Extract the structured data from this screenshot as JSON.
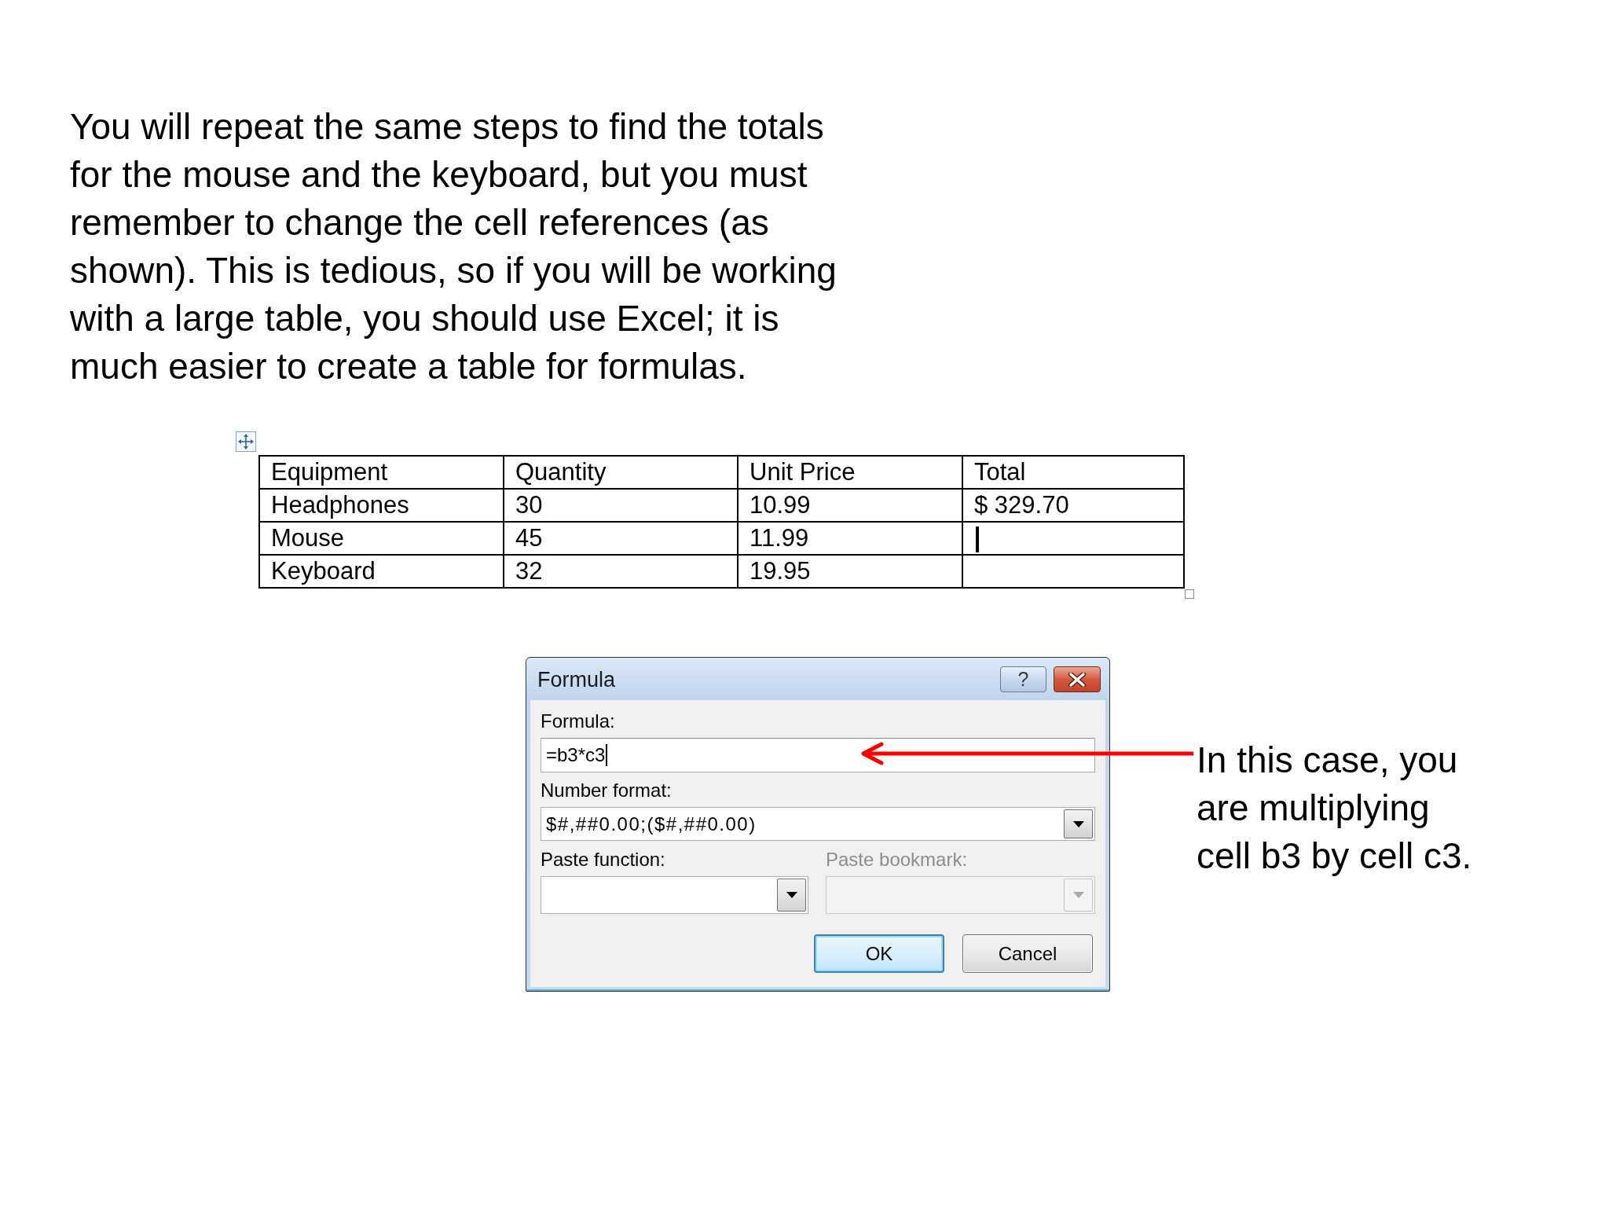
{
  "paragraph": "You will repeat the same steps to find the totals for the mouse and the keyboard, but you must remember to change the cell references (as shown). This is tedious, so if you will be working with a large table, you should use Excel; it is much easier to create a table for formulas.",
  "table": {
    "columns": [
      "Equipment",
      "Quantity",
      "Unit Price",
      "Total"
    ],
    "rows": [
      {
        "cells": [
          "Headphones",
          "30",
          "10.99",
          "$ 329.70"
        ],
        "text_cursor": false
      },
      {
        "cells": [
          "Mouse",
          "45",
          "11.99"
        ],
        "text_cursor": true
      },
      {
        "cells": [
          "Keyboard",
          "32",
          "19.95"
        ],
        "text_cursor": false
      }
    ]
  },
  "dialog": {
    "title": "Formula",
    "help_label": "?",
    "fields": [
      {
        "kind": "text",
        "label": "Formula:",
        "value": "=b3*c3",
        "focused": true,
        "disabled": false
      },
      {
        "kind": "dropdown",
        "label": "Number format:",
        "value": "$#,##0.00;($#,##0.00)",
        "focused": false,
        "disabled": false
      }
    ],
    "paste_row": [
      {
        "label": "Paste function:",
        "disabled": false
      },
      {
        "label": "Paste bookmark:",
        "disabled": true
      }
    ],
    "buttons": [
      {
        "label": "OK",
        "default": true
      },
      {
        "label": "Cancel",
        "default": false
      }
    ]
  },
  "callout": "In this case, you are multiplying cell b3 by cell c3."
}
